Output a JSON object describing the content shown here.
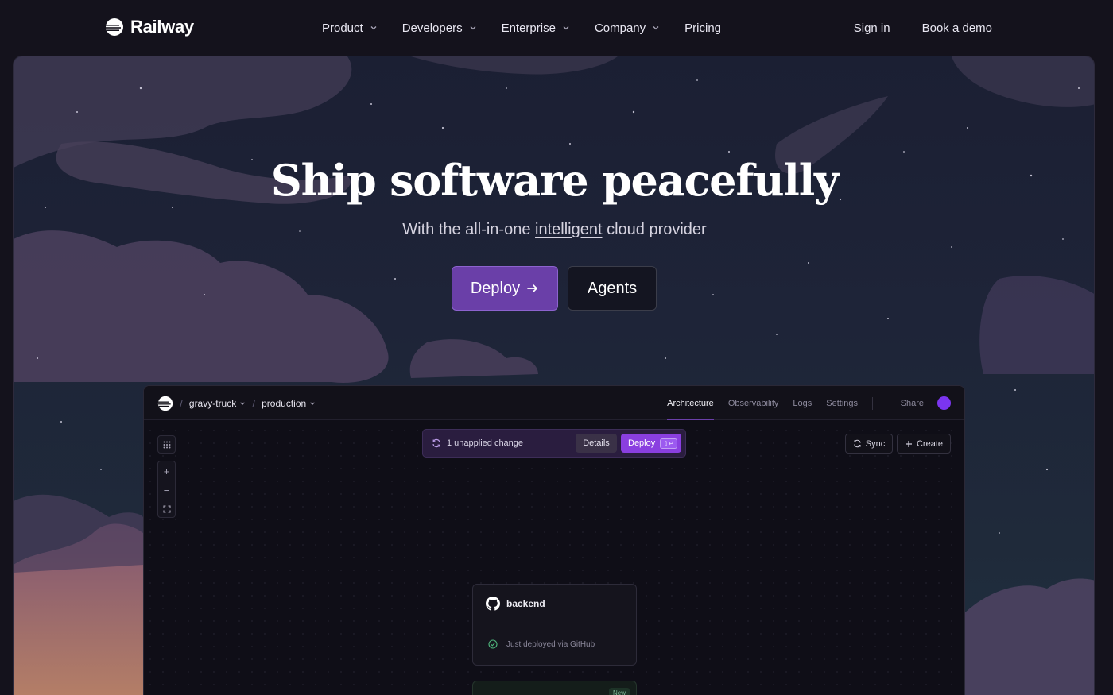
{
  "brand": {
    "name": "Railway"
  },
  "nav": {
    "items": [
      {
        "label": "Product",
        "has_menu": true
      },
      {
        "label": "Developers",
        "has_menu": true
      },
      {
        "label": "Enterprise",
        "has_menu": true
      },
      {
        "label": "Company",
        "has_menu": true
      },
      {
        "label": "Pricing",
        "has_menu": false
      }
    ],
    "sign_in": "Sign in",
    "book_demo": "Book a demo"
  },
  "hero": {
    "title": "Ship software peacefully",
    "subtitle_before": "With the all-in-one ",
    "subtitle_emph": "intelligent",
    "subtitle_after": " cloud provider",
    "primary_cta": "Deploy",
    "primary_cta_icon": "arrow-right-icon",
    "secondary_cta": "Agents"
  },
  "app": {
    "project": "gravy-truck",
    "environment": "production",
    "tabs": [
      {
        "label": "Architecture",
        "active": true
      },
      {
        "label": "Observability",
        "active": false
      },
      {
        "label": "Logs",
        "active": false
      },
      {
        "label": "Settings",
        "active": false
      }
    ],
    "share": "Share",
    "avatar_color": "#7b35f0",
    "changes": {
      "text": "1 unapplied change",
      "details": "Details",
      "deploy": "Deploy",
      "shortcut": "⇧↵"
    },
    "sync": "Sync",
    "create": "Create",
    "zoom": {
      "in": "+",
      "out": "−"
    },
    "service": {
      "name": "backend",
      "status": "Just deployed via GitHub"
    },
    "service2_badge": "New"
  },
  "colors": {
    "accent": "#6a3fa8",
    "deploy_button": "#8a3fe0",
    "background": "#14121c"
  }
}
